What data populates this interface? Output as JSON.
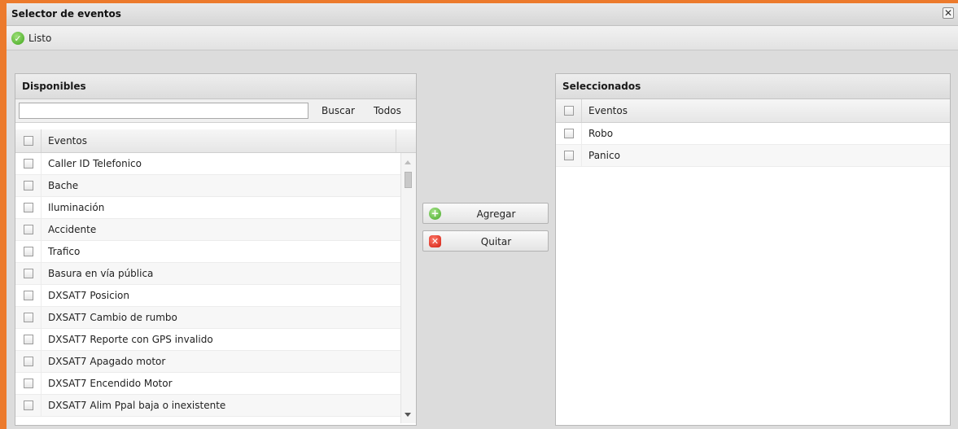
{
  "window": {
    "title": "Selector de eventos",
    "close_glyph": "✕",
    "accent_color": "#ec7a2c"
  },
  "toolbar": {
    "done_label": "Listo",
    "done_icon": "check-circle-icon"
  },
  "available": {
    "title": "Disponibles",
    "search_value": "",
    "search_label": "Buscar",
    "all_label": "Todos",
    "column_header": "Eventos",
    "items": [
      "Caller ID Telefonico",
      "Bache",
      "Iluminación",
      "Accidente",
      "Trafico",
      "Basura en vía pública",
      "DXSAT7 Posicion",
      "DXSAT7 Cambio de rumbo",
      "DXSAT7 Reporte con GPS invalido",
      "DXSAT7 Apagado motor",
      "DXSAT7 Encendido Motor",
      "DXSAT7 Alim Ppal baja o inexistente"
    ]
  },
  "actions": {
    "add_label": "Agregar",
    "add_icon": "plus-circle-icon",
    "remove_label": "Quitar",
    "remove_icon": "x-square-icon"
  },
  "selected": {
    "title": "Seleccionados",
    "column_header": "Eventos",
    "items": [
      "Robo",
      "Panico"
    ]
  }
}
